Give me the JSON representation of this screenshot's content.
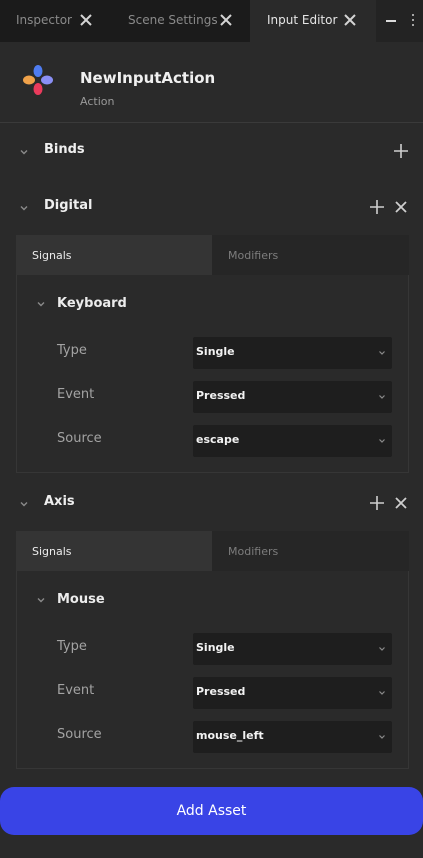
{
  "tabs": [
    {
      "label": "Inspector",
      "active": false
    },
    {
      "label": "Scene Settings",
      "active": false
    },
    {
      "label": "Input Editor",
      "active": true
    }
  ],
  "window_controls": {
    "minimize": "minimize-icon",
    "menu": "kebab-menu-icon"
  },
  "asset": {
    "name": "NewInputAction",
    "type": "Action",
    "icon": "gamepad-dots-icon"
  },
  "sections": {
    "binds": {
      "title": "Binds"
    },
    "digital": {
      "title": "Digital",
      "tabs": {
        "signals": "Signals",
        "modifiers": "Modifiers"
      },
      "group": {
        "title": "Keyboard",
        "properties": [
          {
            "label": "Type",
            "value": "Single"
          },
          {
            "label": "Event",
            "value": "Pressed"
          },
          {
            "label": "Source",
            "value": "escape"
          }
        ]
      }
    },
    "axis": {
      "title": "Axis",
      "tabs": {
        "signals": "Signals",
        "modifiers": "Modifiers"
      },
      "group": {
        "title": "Mouse",
        "properties": [
          {
            "label": "Type",
            "value": "Single"
          },
          {
            "label": "Event",
            "value": "Pressed"
          },
          {
            "label": "Source",
            "value": "mouse_left"
          }
        ]
      }
    }
  },
  "footer": {
    "add_asset_label": "Add Asset"
  },
  "colors": {
    "accent": "#3944e6",
    "background": "#2a2a2a",
    "tabbar": "#1b1b1b"
  }
}
